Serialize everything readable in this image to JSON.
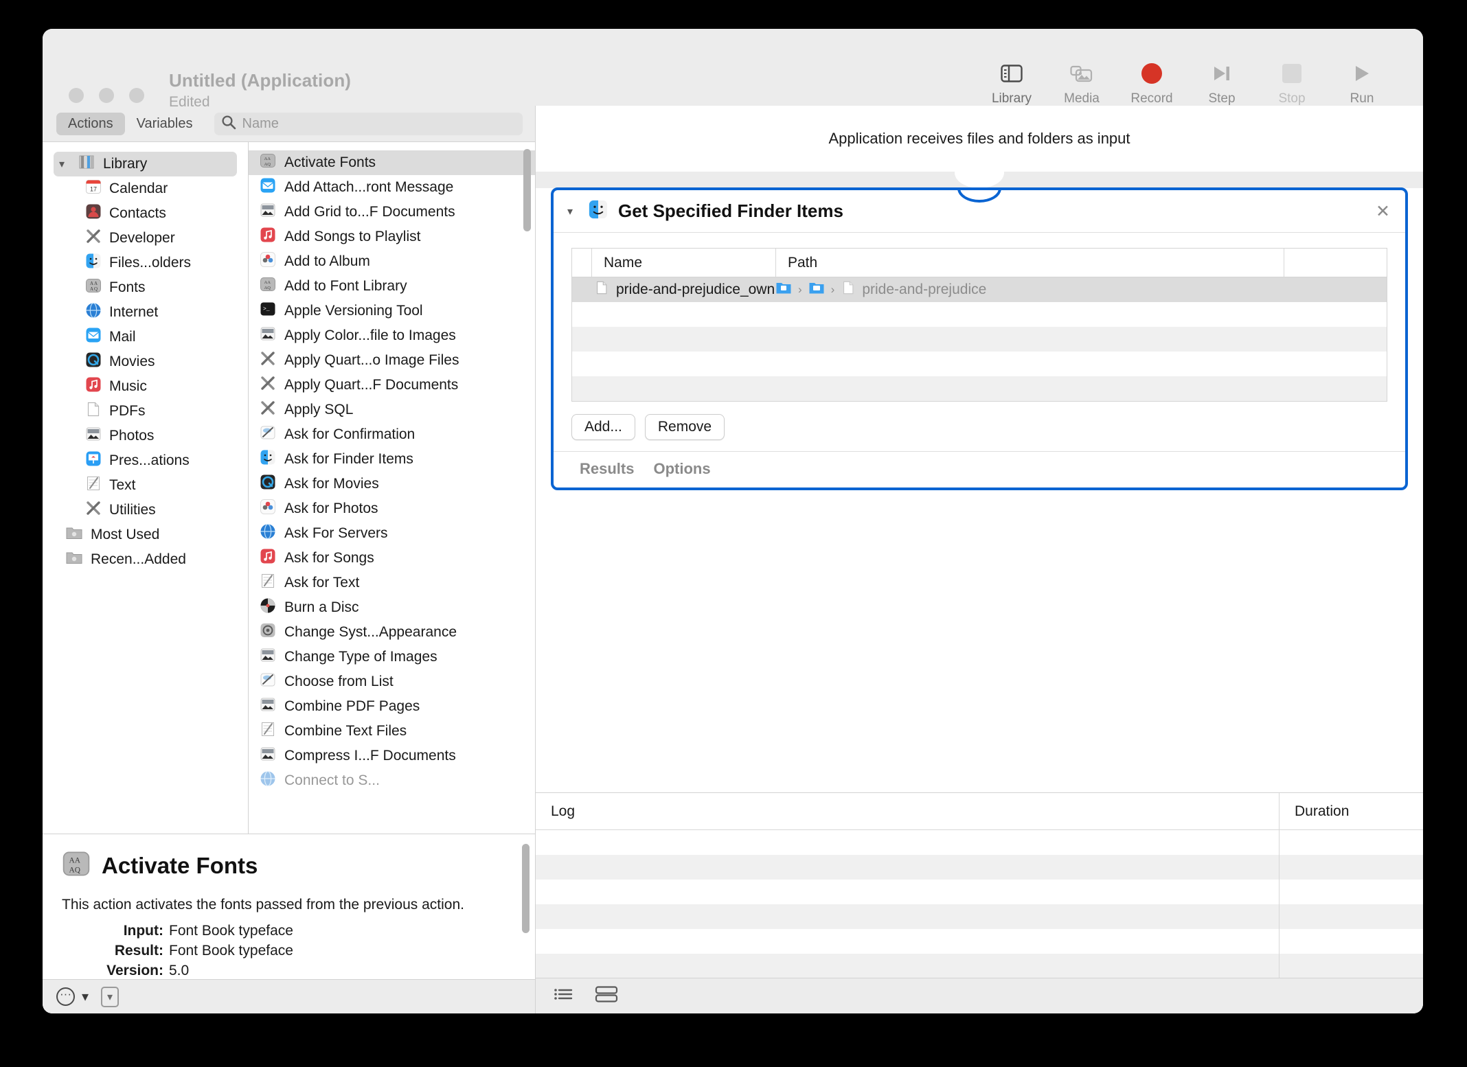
{
  "window": {
    "title": "Untitled (Application)",
    "subtitle": "Edited"
  },
  "toolbar": {
    "items": [
      {
        "label": "Library",
        "icon": "sidebar-icon"
      },
      {
        "label": "Media",
        "icon": "media-icon"
      },
      {
        "label": "Record",
        "icon": "record-icon"
      },
      {
        "label": "Step",
        "icon": "step-icon"
      },
      {
        "label": "Stop",
        "icon": "stop-icon"
      },
      {
        "label": "Run",
        "icon": "run-icon"
      }
    ]
  },
  "library": {
    "tabs": [
      {
        "label": "Actions",
        "active": true
      },
      {
        "label": "Variables",
        "active": false
      }
    ],
    "search_placeholder": "Name",
    "categories": [
      {
        "label": "Library",
        "icon": "library-icon",
        "level": 0
      },
      {
        "label": "Calendar",
        "icon": "calendar-icon",
        "level": 1
      },
      {
        "label": "Contacts",
        "icon": "contacts-icon",
        "level": 1
      },
      {
        "label": "Developer",
        "icon": "developer-icon",
        "level": 1
      },
      {
        "label": "Files...olders",
        "icon": "finder-icon",
        "level": 1
      },
      {
        "label": "Fonts",
        "icon": "fonts-icon",
        "level": 1
      },
      {
        "label": "Internet",
        "icon": "internet-icon",
        "level": 1
      },
      {
        "label": "Mail",
        "icon": "mail-icon",
        "level": 1
      },
      {
        "label": "Movies",
        "icon": "movies-icon",
        "level": 1
      },
      {
        "label": "Music",
        "icon": "music-icon",
        "level": 1
      },
      {
        "label": "PDFs",
        "icon": "pdf-icon",
        "level": 1
      },
      {
        "label": "Photos",
        "icon": "photos-icon",
        "level": 1
      },
      {
        "label": "Pres...ations",
        "icon": "keynote-icon",
        "level": 1
      },
      {
        "label": "Text",
        "icon": "text-icon",
        "level": 1
      },
      {
        "label": "Utilities",
        "icon": "utilities-icon",
        "level": 1
      },
      {
        "label": "Most Used",
        "icon": "smart-folder-icon",
        "level": 2
      },
      {
        "label": "Recen...Added",
        "icon": "smart-folder-icon",
        "level": 2
      }
    ],
    "actions": [
      {
        "label": "Activate Fonts",
        "icon": "fonts-icon",
        "selected": true
      },
      {
        "label": "Add Attach...ront Message",
        "icon": "mail-icon"
      },
      {
        "label": "Add Grid to...F Documents",
        "icon": "photos-app-icon"
      },
      {
        "label": "Add Songs to Playlist",
        "icon": "music-icon"
      },
      {
        "label": "Add to Album",
        "icon": "photos-flower-icon"
      },
      {
        "label": "Add to Font Library",
        "icon": "fonts-icon"
      },
      {
        "label": "Apple Versioning Tool",
        "icon": "terminal-icon"
      },
      {
        "label": "Apply Color...file to Images",
        "icon": "photos-app-icon"
      },
      {
        "label": "Apply Quart...o Image Files",
        "icon": "utilities-icon"
      },
      {
        "label": "Apply Quart...F Documents",
        "icon": "utilities-icon"
      },
      {
        "label": "Apply SQL",
        "icon": "utilities-icon"
      },
      {
        "label": "Ask for Confirmation",
        "icon": "ask-icon"
      },
      {
        "label": "Ask for Finder Items",
        "icon": "finder-icon"
      },
      {
        "label": "Ask for Movies",
        "icon": "movies-icon"
      },
      {
        "label": "Ask for Photos",
        "icon": "photos-flower-icon"
      },
      {
        "label": "Ask For Servers",
        "icon": "internet-icon"
      },
      {
        "label": "Ask for Songs",
        "icon": "music-icon"
      },
      {
        "label": "Ask for Text",
        "icon": "text-icon"
      },
      {
        "label": "Burn a Disc",
        "icon": "disc-icon"
      },
      {
        "label": "Change Syst...Appearance",
        "icon": "settings-icon"
      },
      {
        "label": "Change Type of Images",
        "icon": "photos-app-icon"
      },
      {
        "label": "Choose from List",
        "icon": "ask-icon"
      },
      {
        "label": "Combine PDF Pages",
        "icon": "photos-app-icon"
      },
      {
        "label": "Combine Text Files",
        "icon": "text-icon"
      },
      {
        "label": "Compress I...F Documents",
        "icon": "photos-app-icon"
      },
      {
        "label": "Connect to S...",
        "icon": "internet-icon"
      }
    ]
  },
  "description": {
    "title": "Activate Fonts",
    "icon": "fonts-icon",
    "body": "This action activates the fonts passed from the previous action.",
    "meta": [
      {
        "key": "Input:",
        "value": "Font Book typeface"
      },
      {
        "key": "Result:",
        "value": "Font Book typeface"
      },
      {
        "key": "Version:",
        "value": "5.0"
      }
    ]
  },
  "status_bar": {
    "menu_icon": "ellipsis-circle-icon",
    "chevron_icon": "chevron-down-icon",
    "box_icon": "chevron-down-box-icon"
  },
  "workflow": {
    "header": "Application receives files and folders as input",
    "action_card": {
      "title": "Get Specified Finder Items",
      "icon": "finder-icon",
      "disclosure_icon": "chevron-down-icon",
      "close_icon": "close-icon",
      "border_color": "#0a64d2",
      "table": {
        "columns": [
          "Name",
          "Path"
        ],
        "rows": [
          {
            "name": "pride-and-prejudice_own",
            "path_crumbs": [
              "folder-icon",
              "folder-icon",
              "file-icon"
            ],
            "path_text": "pride-and-prejudice"
          }
        ],
        "empty_rows": 4
      },
      "buttons": [
        {
          "label": "Add..."
        },
        {
          "label": "Remove"
        }
      ],
      "tabs": [
        {
          "label": "Results"
        },
        {
          "label": "Options"
        }
      ]
    }
  },
  "log": {
    "columns": [
      "Log",
      "Duration"
    ],
    "rows": []
  },
  "bottom_bar": {
    "view_list_icon": "list-view-icon",
    "view_split_icon": "split-view-icon"
  }
}
